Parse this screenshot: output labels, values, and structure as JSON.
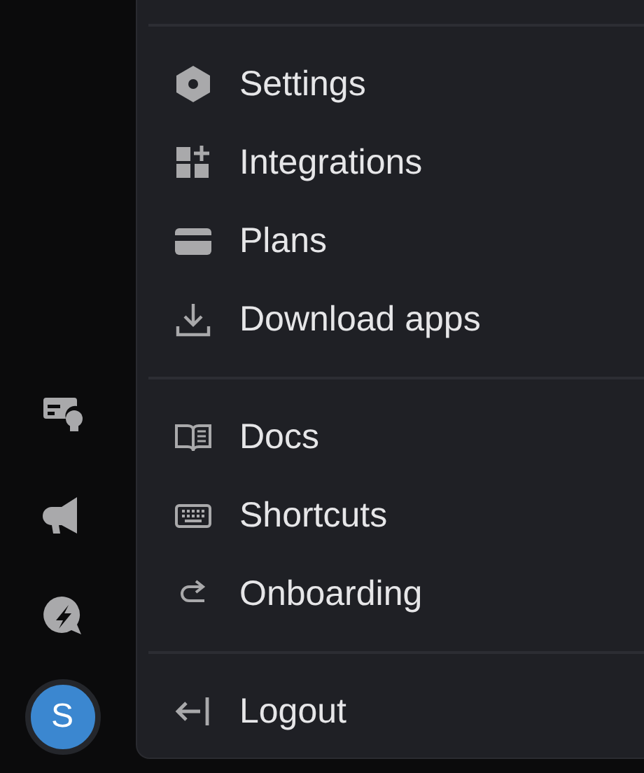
{
  "sidebar": {
    "avatar": {
      "initial": "S"
    }
  },
  "menu": {
    "sections": [
      {
        "items": [
          {
            "label": "Settings"
          },
          {
            "label": "Integrations"
          },
          {
            "label": "Plans"
          },
          {
            "label": "Download apps"
          }
        ]
      },
      {
        "items": [
          {
            "label": "Docs"
          },
          {
            "label": "Shortcuts"
          },
          {
            "label": "Onboarding"
          }
        ]
      },
      {
        "items": [
          {
            "label": "Logout"
          }
        ]
      }
    ]
  }
}
